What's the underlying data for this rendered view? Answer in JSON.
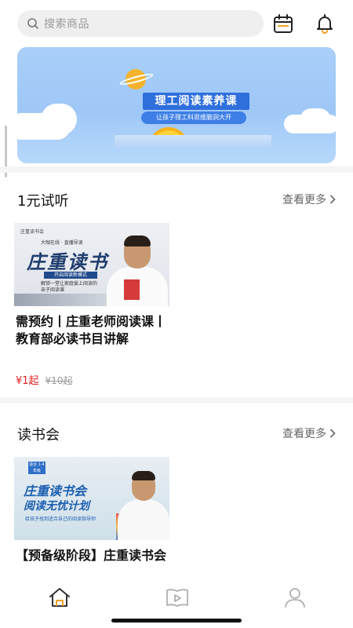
{
  "search": {
    "placeholder": "搜索商品"
  },
  "header": {
    "calendar_icon": "calendar-icon",
    "bell_icon": "bell-icon"
  },
  "banner": {
    "title": "理工阅读素养课",
    "subtitle": "让孩子理工科思维脑洞大开"
  },
  "sections": [
    {
      "title": "1元试听",
      "more_label": "查看更多",
      "course": {
        "thumb_logo": "庄重读书会",
        "thumb_slogan": "大咖在线 · 直播导读",
        "thumb_brand": "庄重读书",
        "thumb_badge": "开启阅读新模式",
        "thumb_desc_1": "解锁一堂让家庭爱上阅读的",
        "thumb_desc_2": "亲子阅读课",
        "title": "需预约丨庄重老师阅读课丨教育部必读书目讲解",
        "price": "¥1起",
        "original_price": "¥10起"
      }
    },
    {
      "title": "读书会",
      "more_label": "查看更多",
      "course": {
        "thumb_tag": "适合 1-4年级",
        "thumb_brand": "庄重读书会",
        "thumb_sub": "阅读无忧计划",
        "thumb_desc": "给孩子找到适合自己的阅读指导师",
        "title": "【预备级阶段】庄重读书会"
      }
    }
  ],
  "tabbar": {
    "items": [
      "home-icon",
      "video-book-icon",
      "profile-icon"
    ],
    "active": "home-icon",
    "active_color": "#333333",
    "inactive_color": "#b0b0b0"
  }
}
